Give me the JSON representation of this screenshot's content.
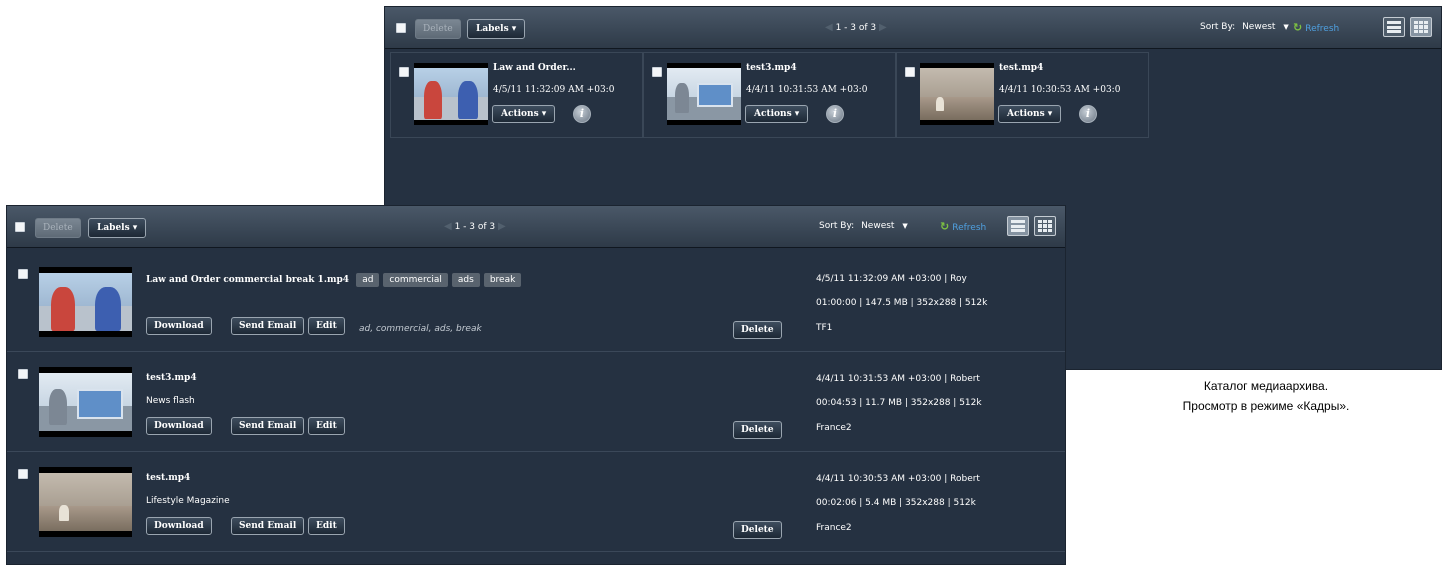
{
  "back_panel": {
    "toolbar": {
      "delete_label": "Delete",
      "labels_label": "Labels ▾",
      "pager_text": "1 - 3 of 3",
      "sort_label": "Sort By:",
      "sort_value": "Newest",
      "refresh_label": "Refresh"
    },
    "cards": [
      {
        "title": "Law and Order...",
        "date": "4/5/11 11:32:09 AM +03:0",
        "actions": "Actions ▾",
        "info": "i"
      },
      {
        "title": "test3.mp4",
        "date": "4/4/11 10:31:53 AM +03:0",
        "actions": "Actions ▾",
        "info": "i"
      },
      {
        "title": "test.mp4",
        "date": "4/4/11 10:30:53 AM +03:0",
        "actions": "Actions ▾",
        "info": "i"
      }
    ]
  },
  "front_panel": {
    "toolbar": {
      "delete_label": "Delete",
      "labels_label": "Labels ▾",
      "pager_text": "1 - 3 of 3",
      "sort_label": "Sort By:",
      "sort_value": "Newest",
      "refresh_label": "Refresh"
    },
    "rows": [
      {
        "name": "Law and Order commercial break 1.mp4",
        "tags": [
          "ad",
          "commercial",
          "ads",
          "break"
        ],
        "subtitle": "",
        "labels_text": "ad, commercial, ads, break",
        "meta1": "4/5/11 11:32:09 AM +03:00 | Roy",
        "meta2": "01:00:00 | 147.5 MB | 352x288 | 512k",
        "meta3": "TF1"
      },
      {
        "name": "test3.mp4",
        "tags": [],
        "subtitle": "News flash",
        "labels_text": "",
        "meta1": "4/4/11 10:31:53 AM +03:00 | Robert",
        "meta2": "00:04:53 | 11.7 MB | 352x288 | 512k",
        "meta3": "France2"
      },
      {
        "name": "test.mp4",
        "tags": [],
        "subtitle": "Lifestyle Magazine",
        "labels_text": "",
        "meta1": "4/4/11 10:30:53 AM +03:00 | Robert",
        "meta2": "00:02:06 | 5.4 MB | 352x288 | 512k",
        "meta3": "France2"
      }
    ],
    "buttons": {
      "download": "Download",
      "send_email": "Send Email",
      "edit": "Edit",
      "delete": "Delete"
    }
  },
  "caption": {
    "line1": "Каталог медиаархива.",
    "line2": "Просмотр в режиме «Кадры»."
  },
  "colors": {
    "panel_bg": "#253141",
    "refresh_blue": "#4fa0e0",
    "refresh_icon_green": "#7dc142"
  }
}
